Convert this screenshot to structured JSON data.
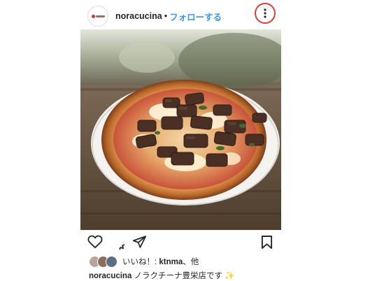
{
  "post": {
    "username": "noracucina",
    "separator": "•",
    "follow_label": "フォローする",
    "more_icon": "more-vertical-icon",
    "highlight_color": "#e53935",
    "follow_color": "#3897f0"
  },
  "actions": {
    "icons": [
      "heart-icon",
      "comment-icon",
      "share-icon",
      "bookmark-icon"
    ]
  },
  "likes": {
    "prefix": "いいね！:",
    "user": "ktnma",
    "suffix": "、他"
  },
  "caption": {
    "username": "noracucina",
    "text": "ノラクチーナ豊栄店です",
    "emoji": "✨"
  }
}
